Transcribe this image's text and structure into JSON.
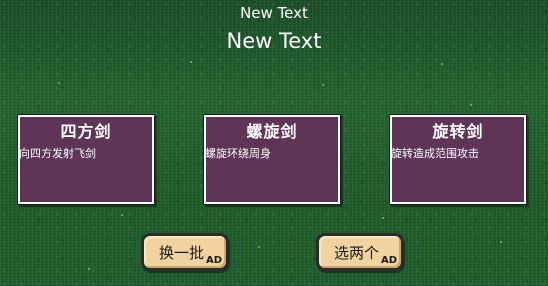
{
  "header": {
    "small_title": "New Text",
    "large_title": "New Text"
  },
  "cards": [
    {
      "name": "四方剑",
      "description": "向四方发射飞剑"
    },
    {
      "name": "螺旋剑",
      "description": "螺旋环绕周身"
    },
    {
      "name": "旋转剑",
      "description": "旋转造成范围攻击"
    }
  ],
  "buttons": {
    "refresh": {
      "label": "换一批",
      "badge": "AD"
    },
    "choose_two": {
      "label": "选两个",
      "badge": "AD"
    }
  },
  "colors": {
    "card_bg": "#5e3557",
    "button_bg": "#f1d3a0",
    "grass": "#1f5a2c"
  }
}
